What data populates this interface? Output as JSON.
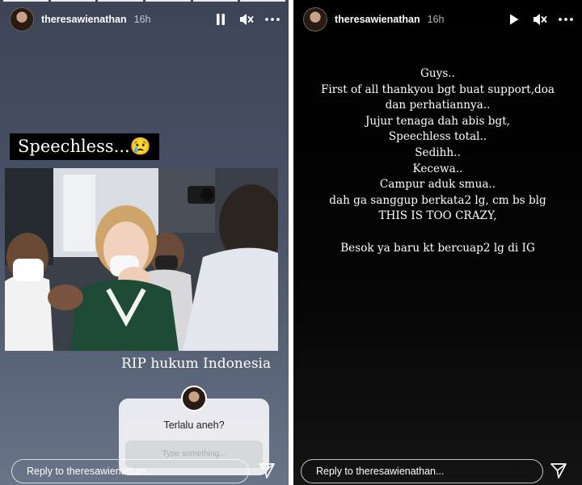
{
  "left_story": {
    "username": "theresawienathan",
    "time": "16h",
    "icons": {
      "pause": "pause-icon",
      "mute": "speaker-muted-icon",
      "more": "more-options-icon",
      "send": "send-paper-plane-icon"
    },
    "caption": "Speechless...",
    "caption_emoji": "😢",
    "photo_caption": "RIP hukum Indonesia",
    "question_sticker": {
      "question": "Terlalu aneh?",
      "placeholder": "Type something..."
    },
    "reply_placeholder": "Reply to theresawienathan..."
  },
  "right_story": {
    "username": "theresawienathan",
    "time": "16h",
    "icons": {
      "play": "play-icon",
      "mute": "speaker-muted-icon",
      "more": "more-options-icon",
      "send": "send-paper-plane-icon"
    },
    "lines": [
      "Guys..",
      "First of all thankyou bgt buat support,doa",
      "dan perhatiannya..",
      "Jujur tenaga dah abis bgt,",
      "Speechless total..",
      "Sedihh..",
      "Kecewa..",
      "Campur aduk smua..",
      "dah ga sanggup berkata2 lg, cm bs blg",
      "THIS IS TOO CRAZY,",
      "",
      "Besok ya baru kt bercuap2 lg di IG"
    ],
    "reply_placeholder": "Reply to theresawienathan..."
  },
  "colors": {
    "left_background_top": "#3c4456",
    "left_background_bottom": "#6a7488",
    "right_background": "#000000",
    "text": "#ffffff"
  }
}
